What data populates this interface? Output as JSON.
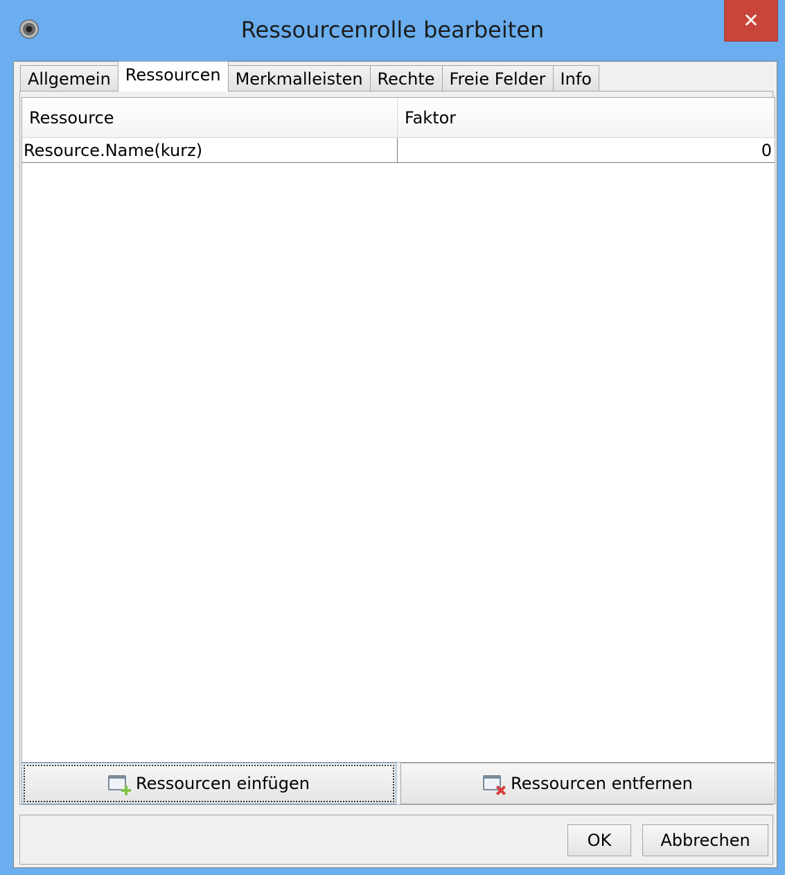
{
  "window": {
    "title": "Ressourcenrolle bearbeiten",
    "close_icon": "close-icon"
  },
  "tabs": [
    {
      "label": "Allgemein",
      "active": false
    },
    {
      "label": "Ressourcen",
      "active": true
    },
    {
      "label": "Merkmalleisten",
      "active": false
    },
    {
      "label": "Rechte",
      "active": false
    },
    {
      "label": "Freie Felder",
      "active": false
    },
    {
      "label": "Info",
      "active": false
    }
  ],
  "table": {
    "columns": [
      "Ressource",
      "Faktor"
    ],
    "rows": [
      [
        "Resource.Name(kurz)",
        "0"
      ]
    ]
  },
  "actions": {
    "add_label": "Ressourcen einfügen",
    "remove_label": "Ressourcen entfernen"
  },
  "dialog": {
    "ok_label": "OK",
    "cancel_label": "Abbrechen"
  },
  "colors": {
    "frame": "#6aaef0",
    "close": "#c74539"
  }
}
